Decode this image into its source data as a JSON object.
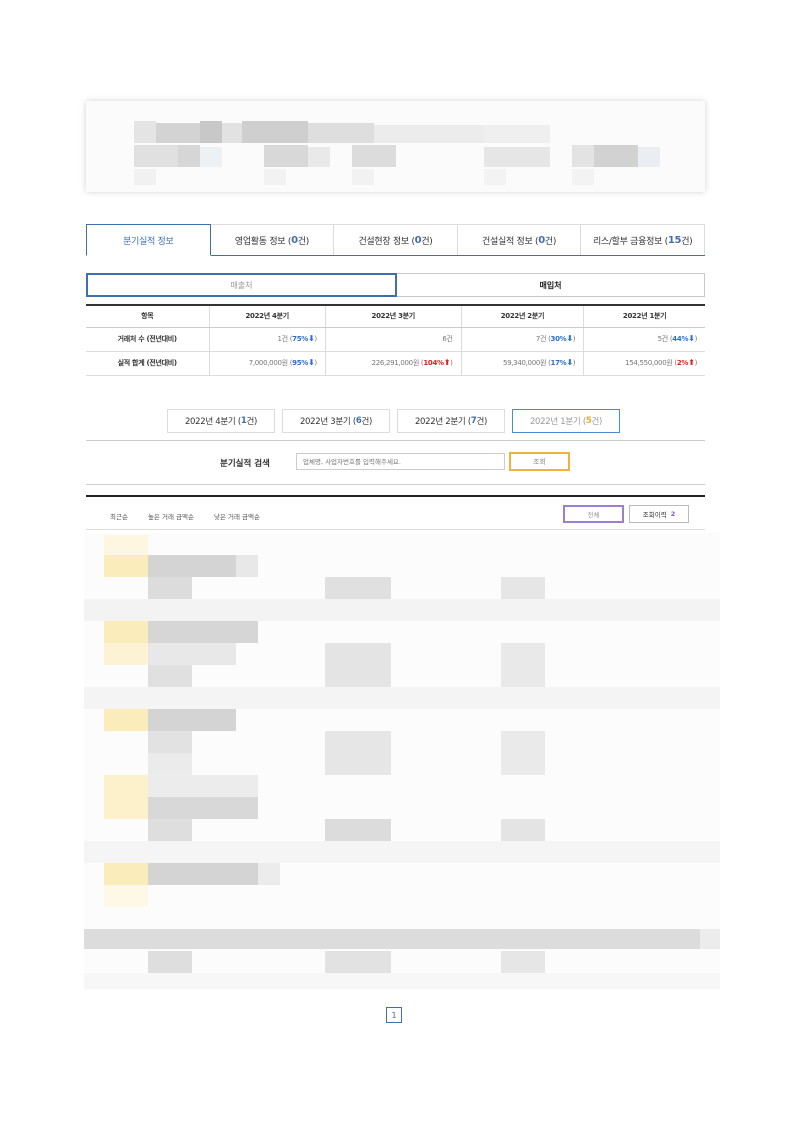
{
  "tabs": [
    {
      "label": "분기실적 정보",
      "count": "",
      "active": true
    },
    {
      "label": "영업활동 정보 (",
      "count": "0",
      "suffix": "건)"
    },
    {
      "label": "건설현장 정보 (",
      "count": "0",
      "suffix": "건)"
    },
    {
      "label": "건설실적 정보 (",
      "count": "0",
      "suffix": "건)"
    },
    {
      "label": "리스/할부 금융정보 (",
      "count": "15",
      "suffix": "건)"
    }
  ],
  "subtoggle": {
    "sales": "매출처",
    "purchase": "매입처"
  },
  "summary": {
    "headers": [
      "항목",
      "2022년 4분기",
      "2022년 3분기",
      "2022년 2분기",
      "2022년 1분기"
    ],
    "rows": [
      {
        "label": "거래처 수 (전년대비)",
        "cells": [
          {
            "value": "1건",
            "pct": "75%",
            "dir": "down"
          },
          {
            "value": "6건",
            "pct": "",
            "dir": ""
          },
          {
            "value": "7건",
            "pct": "30%",
            "dir": "down"
          },
          {
            "value": "5건",
            "pct": "44%",
            "dir": "down"
          }
        ]
      },
      {
        "label": "실적 합계 (전년대비)",
        "cells": [
          {
            "value": "7,000,000원",
            "pct": "95%",
            "dir": "down"
          },
          {
            "value": "226,291,000원",
            "pct": "104%",
            "dir": "up"
          },
          {
            "value": "59,340,000원",
            "pct": "17%",
            "dir": "down"
          },
          {
            "value": "154,550,000원",
            "pct": "2%",
            "dir": "up"
          }
        ]
      }
    ]
  },
  "quarters": [
    {
      "label": "2022년 4분기 (",
      "count": "1",
      "suffix": "건)",
      "selected": false
    },
    {
      "label": "2022년 3분기 (",
      "count": "6",
      "suffix": "건)",
      "selected": false
    },
    {
      "label": "2022년 2분기 (",
      "count": "7",
      "suffix": "건)",
      "selected": false
    },
    {
      "label": "2022년 1분기 (",
      "count": "5",
      "suffix": "건)",
      "selected": true
    }
  ],
  "search": {
    "label": "분기실적 검색",
    "placeholder": "업체명, 사업자번호를 입력해주세요.",
    "button": "조회"
  },
  "sorts": [
    "최근순",
    "높은 거래 금액순",
    "낮은 거래 금액순"
  ],
  "filter": {
    "all": "전체",
    "history": "조회이력",
    "history_count": "2"
  },
  "pager": {
    "current": "1"
  },
  "colors": {
    "accent": "#3f6fb3",
    "down": "#2c6fcf",
    "up": "#d9241c",
    "highlight": "#f0b23a",
    "purple": "#9b7fd0"
  }
}
